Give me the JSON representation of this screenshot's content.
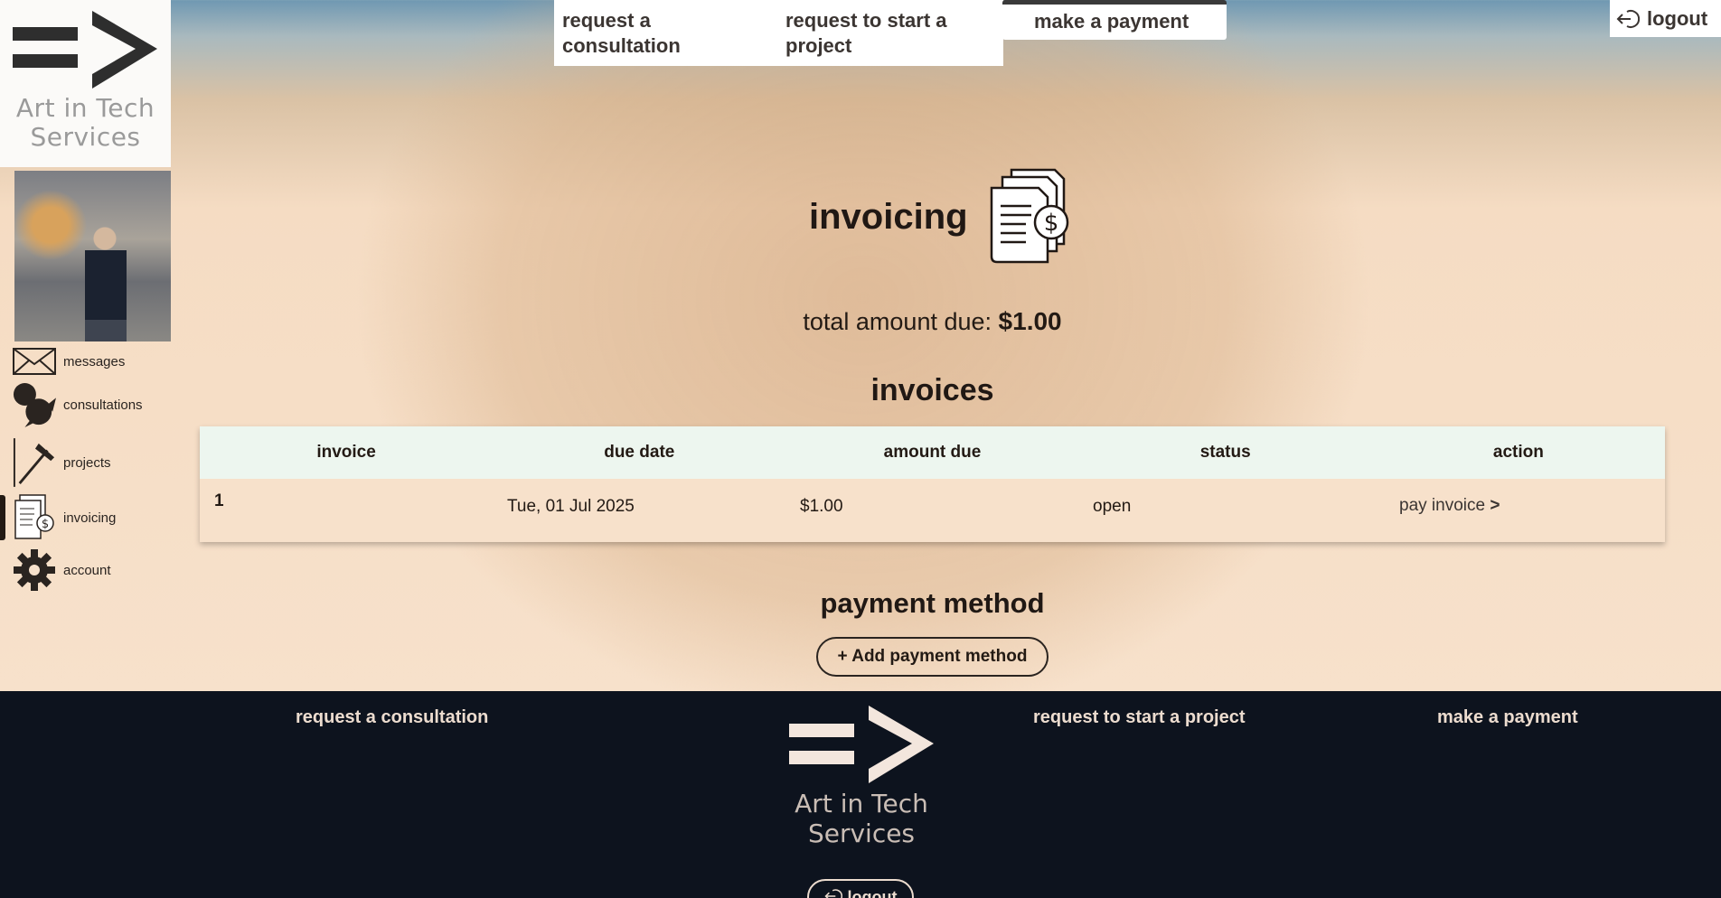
{
  "brand": {
    "line1": "Art in Tech",
    "line2": "Services"
  },
  "topnav": {
    "consultation": "request a consultation",
    "project": "request to start a project",
    "payment": "make a payment",
    "logout": "logout"
  },
  "sidebar": {
    "items": [
      {
        "label": "messages",
        "icon": "envelope-icon"
      },
      {
        "label": "consultations",
        "icon": "speech-bubbles-icon"
      },
      {
        "label": "projects",
        "icon": "hammer-icon"
      },
      {
        "label": "invoicing",
        "icon": "invoice-icon"
      },
      {
        "label": "account",
        "icon": "gear-icon"
      }
    ],
    "active": "invoicing"
  },
  "main": {
    "title": "invoicing",
    "total_label": "total amount due:",
    "total_value": "$1.00",
    "invoices_heading": "invoices",
    "table": {
      "headers": [
        "invoice",
        "due date",
        "amount due",
        "status",
        "action"
      ],
      "rows": [
        {
          "invoice": "1",
          "due_date": "Tue, 01 Jul 2025",
          "amount_due": "$1.00",
          "status": "open",
          "action": "pay invoice",
          "action_arrow": ">"
        }
      ]
    },
    "payment_heading": "payment method",
    "add_payment_label": "+ Add payment method"
  },
  "footer": {
    "consultation": "request a consultation",
    "project": "request to start a project",
    "payment": "make a payment",
    "logout": "logout"
  },
  "colors": {
    "footer_bg": "#0d131e",
    "table_header_bg": "#edf6ef",
    "page_bg": "#f7e1cb",
    "text": "#231a14"
  }
}
